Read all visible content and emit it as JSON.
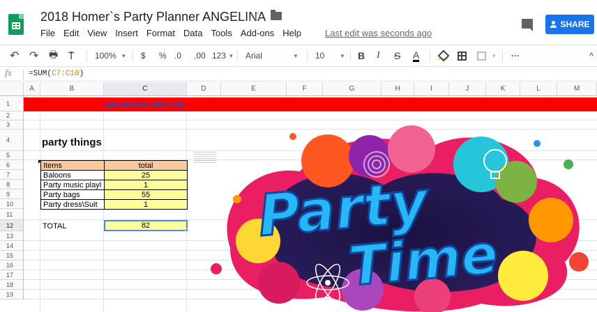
{
  "document": {
    "title": "2018 Homer`s Party Planner ANGELINA",
    "last_edit": "Last edit was seconds ago",
    "share_label": "SHARE"
  },
  "menu": [
    "File",
    "Edit",
    "View",
    "Insert",
    "Format",
    "Data",
    "Tools",
    "Add-ons",
    "Help"
  ],
  "toolbar": {
    "zoom": "100%",
    "currency": "$",
    "percent": "%",
    "decimal_less": ".0",
    "decimal_more": ".00",
    "more_formats": "123",
    "font": "Arial",
    "font_size": "10",
    "bold": "B",
    "italic": "I",
    "strike": "S",
    "text_color": "A",
    "more": "···",
    "collapse": "^"
  },
  "formula_bar": {
    "fx": "fx",
    "prefix": "=SUM(",
    "range": "C7:C10",
    "suffix": ")"
  },
  "columns": [
    "A",
    "B",
    "C",
    "D",
    "E",
    "F",
    "G",
    "H",
    "I",
    "J",
    "K",
    "L",
    "M"
  ],
  "rows": [
    "1",
    "2",
    "3",
    "4",
    "5",
    "6",
    "7",
    "8",
    "9",
    "10",
    "11",
    "12",
    "13",
    "14",
    "15",
    "16",
    "17",
    "18",
    "19"
  ],
  "sheet": {
    "help_link": "Spreadsheet video help",
    "heading": "party things",
    "table_header": {
      "item": "Items",
      "total": "total"
    },
    "items": [
      {
        "name": "Baloons",
        "total": "25"
      },
      {
        "name": "Party music playl",
        "total": "1"
      },
      {
        "name": "Party bags",
        "total": "55"
      },
      {
        "name": "Party dress\\Suit",
        "total": "1"
      }
    ],
    "total_label": "TOTAL",
    "total_value": "82"
  },
  "image": {
    "word1": "Party",
    "word2": "Time"
  },
  "colors": {
    "accent": "#1a73e8",
    "sheets_green": "#0f9d58",
    "red_band": "#ff0000",
    "header_fill": "#f9cb9c",
    "value_fill": "#ffff99"
  }
}
